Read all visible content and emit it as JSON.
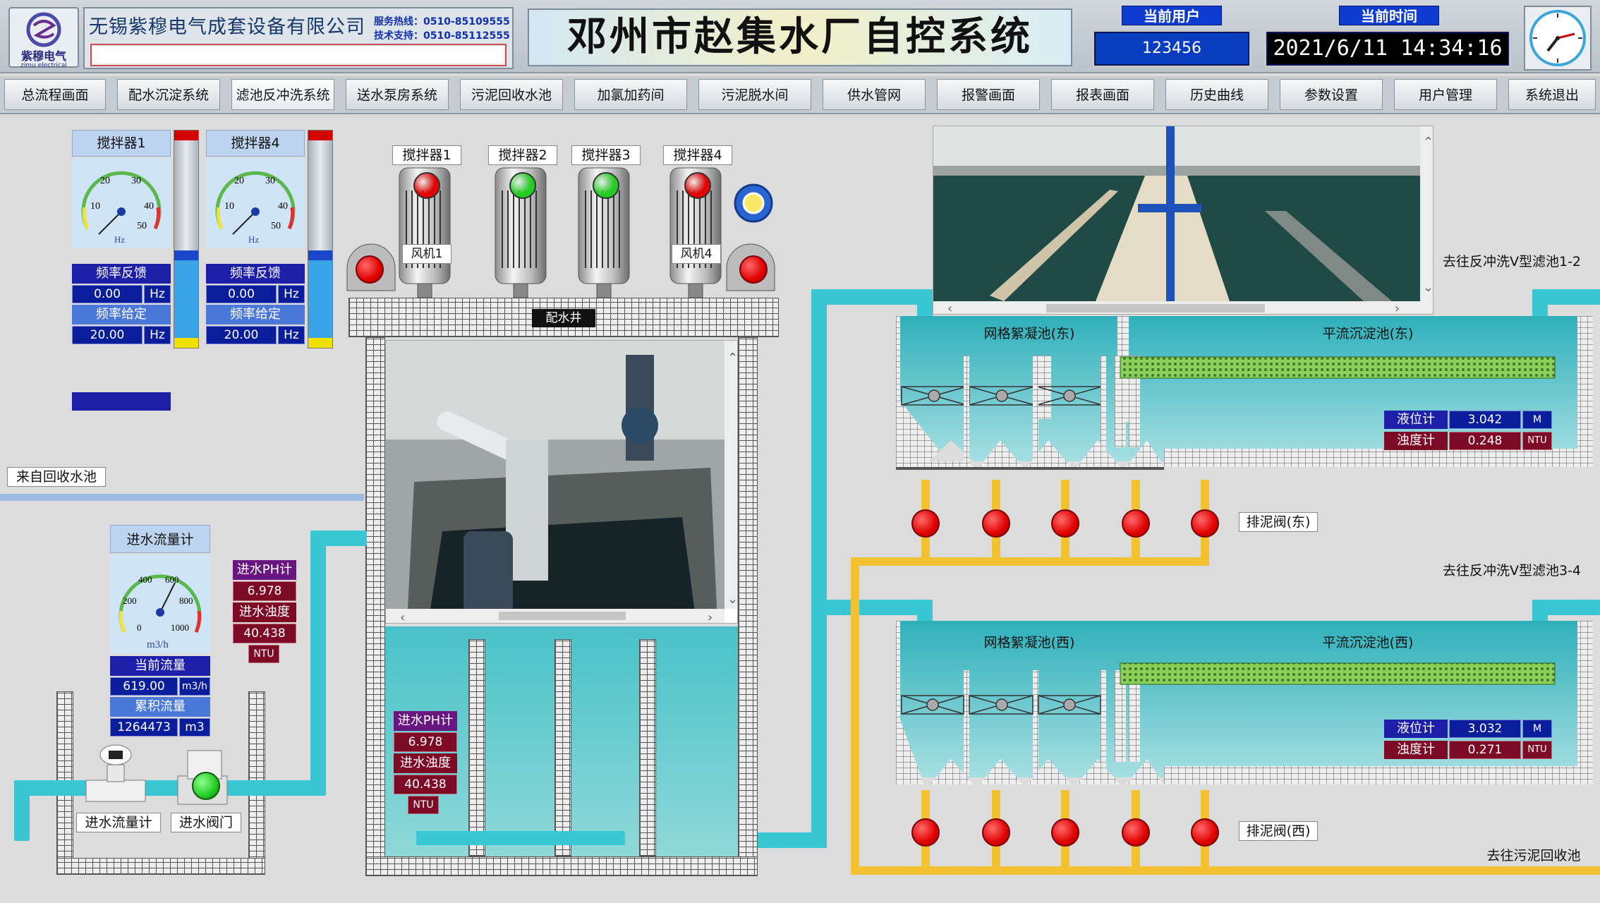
{
  "header": {
    "logo_text": "紫穆电气",
    "logo_sub": "zimu electrical",
    "company_name": "无锡紫穆电气成套设备有限公司",
    "service_line": "服务热线：0510-85109555",
    "tech_support": "技术支持：0510-85112555",
    "system_title": "邓州市赵集水厂自控系统",
    "current_user_label": "当前用户",
    "current_user": "123456",
    "current_time_label": "当前时间",
    "current_time": "2021/6/11  14:34:16"
  },
  "nav": [
    "总流程画面",
    "配水沉淀系统",
    "滤池反冲洗系统",
    "送水泵房系统",
    "污泥回收水池",
    "加氯加药间",
    "污泥脱水间",
    "供水管网",
    "报警画面",
    "报表画面",
    "历史曲线",
    "参数设置",
    "用户管理",
    "系统退出"
  ],
  "vfd_panels": [
    {
      "title": "搅拌器1",
      "unit": "Hz",
      "ticks": [
        "10",
        "20",
        "30",
        "40",
        "50"
      ],
      "feedback_label": "频率反馈",
      "feedback": "0.00",
      "setpoint_label": "频率给定",
      "setpoint": "20.00",
      "feedback_unit": "Hz",
      "setpoint_unit": "Hz"
    },
    {
      "title": "搅拌器4",
      "unit": "Hz",
      "ticks": [
        "10",
        "20",
        "30",
        "40",
        "50"
      ],
      "feedback_label": "频率反馈",
      "feedback": "0.00",
      "setpoint_label": "频率给定",
      "setpoint": "20.00",
      "feedback_unit": "Hz",
      "setpoint_unit": "Hz"
    }
  ],
  "mixers": [
    {
      "label": "搅拌器1",
      "status": "stopped",
      "status_color": "#e00000"
    },
    {
      "label": "搅拌器2",
      "status": "running",
      "status_color": "#22cc22"
    },
    {
      "label": "搅拌器3",
      "status": "running",
      "status_color": "#22cc22"
    },
    {
      "label": "搅拌器4",
      "status": "stopped",
      "status_color": "#e00000"
    }
  ],
  "fans": [
    "风机1",
    "风机4"
  ],
  "distribution_well": "配水井",
  "inflow_meter": {
    "title": "进水流量计",
    "unit": "m3/h",
    "ticks": [
      "0",
      "200",
      "400",
      "600",
      "800",
      "1000"
    ],
    "current_label": "当前流量",
    "current": "619.00",
    "current_unit": "m3/h",
    "total_label": "累积流量",
    "total": "1264473",
    "total_unit": "m3"
  },
  "ph_turbidity_left": {
    "ph_label": "进水PH计",
    "ph": "6.978",
    "turb_label": "进水浊度",
    "turb": "40.438",
    "unit": "NTU"
  },
  "ph_turbidity_center": {
    "ph_label": "进水PH计",
    "ph": "6.978",
    "turb_label": "进水浊度",
    "turb": "40.438",
    "unit": "NTU"
  },
  "labels": {
    "from_recovery": "来自回收水池",
    "inflow_meter": "进水流量计",
    "inflow_valve": "进水阀门",
    "to_filter_12": "去往反冲洗V型滤池1-2",
    "to_filter_34": "去往反冲洗V型滤池3-4",
    "to_sludge": "去往污泥回收池",
    "flocc_east": "网格絮凝池(东)",
    "sed_east": "平流沉淀池(东)",
    "flocc_west": "网格絮凝池(西)",
    "sed_west": "平流沉淀池(西)",
    "drain_east": "排泥阀(东)",
    "drain_west": "排泥阀(西)"
  },
  "tank_east": {
    "level_label": "液位计",
    "level": "3.042",
    "level_unit": "M",
    "turb_label": "浊度计",
    "turb": "0.248",
    "turb_unit": "NTU"
  },
  "tank_west": {
    "level_label": "液位计",
    "level": "3.032",
    "level_unit": "M",
    "turb_label": "浊度计",
    "turb": "0.271",
    "turb_unit": "NTU"
  },
  "colors": {
    "pipe_water": "#39c7d4",
    "pipe_sludge": "#f2c231",
    "valve_closed": "#e00000",
    "running": "#22cc22",
    "header_blue": "#0e3bd0"
  }
}
